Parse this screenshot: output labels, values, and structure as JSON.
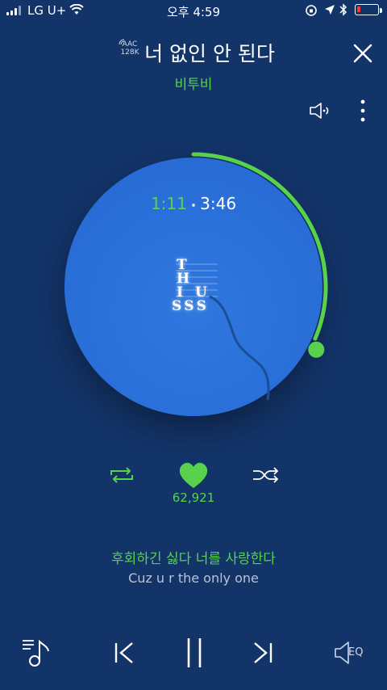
{
  "status_bar": {
    "carrier": "LG U+",
    "time": "오후 4:59"
  },
  "header": {
    "codec_line1": "AAC",
    "codec_line2": "128K",
    "title": "너 없인 안 된다",
    "artist": "비투비"
  },
  "player": {
    "current_time": "1:11",
    "separator": "•",
    "total_time": "3:46",
    "progress_fraction": 0.314,
    "like_count": "62,921",
    "art_text": [
      "T",
      "H",
      "I",
      "S",
      "U",
      "S",
      "S"
    ]
  },
  "lyrics": {
    "current": "후회하긴 싫다 너를 사랑한다",
    "translation": "Cuz u r the only one"
  },
  "bottom": {
    "eq_label": "EQ"
  },
  "colors": {
    "background": "#133469",
    "accent": "#57d24a",
    "disc": "#2a6fd9"
  }
}
